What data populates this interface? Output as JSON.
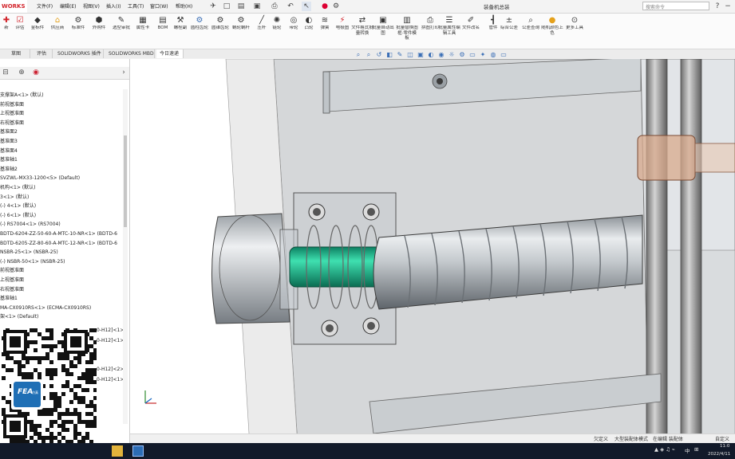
{
  "app": {
    "brand": "WORKS",
    "document_title": "装备机总装"
  },
  "menu": [
    "文件(F)",
    "编辑(E)",
    "视图(V)",
    "插入(I)",
    "工具(T)",
    "窗口(W)",
    "帮助(H)"
  ],
  "search": {
    "placeholder": "搜索命令"
  },
  "ribbon": [
    {
      "label": "新",
      "icon": "new-icon"
    },
    {
      "label": "评估",
      "icon": "evaluate-icon"
    },
    {
      "label": "金标件",
      "icon": "gold-part-icon"
    },
    {
      "label": "供应商",
      "icon": "supplier-icon"
    },
    {
      "label": "标准件",
      "icon": "standard-part-icon"
    },
    {
      "label": "外购件",
      "icon": "purchased-part-icon"
    },
    {
      "label": "选型审批",
      "icon": "approval-icon"
    },
    {
      "label": "属性卡",
      "icon": "property-card-icon"
    },
    {
      "label": "BOM",
      "icon": "bom-icon"
    },
    {
      "label": "螺栓副",
      "icon": "bolt-icon"
    },
    {
      "label": "圆柱齿轮",
      "icon": "spur-gear-icon"
    },
    {
      "label": "圆锥齿轮",
      "icon": "bevel-gear-icon"
    },
    {
      "label": "蜗轮蜗杆",
      "icon": "worm-gear-icon"
    },
    {
      "label": "压杆",
      "icon": "strut-icon"
    },
    {
      "label": "链轮",
      "icon": "sprocket-icon"
    },
    {
      "label": "带轮",
      "icon": "pulley-icon"
    },
    {
      "label": "凸轮",
      "icon": "cam-icon"
    },
    {
      "label": "弹簧",
      "icon": "spring-icon"
    },
    {
      "label": "电极图",
      "icon": "electrode-icon"
    },
    {
      "label": "文件格式批量转换",
      "icon": "batch-convert-icon"
    },
    {
      "label": "批量自动出图",
      "icon": "auto-drawing-icon"
    },
    {
      "label": "批量替换图框·零件模板",
      "icon": "replace-template-icon"
    },
    {
      "label": "拼图打印",
      "icon": "print-icon"
    },
    {
      "label": "批量属性编辑工具",
      "icon": "batch-property-icon"
    },
    {
      "label": "文件改名",
      "icon": "rename-icon"
    },
    {
      "label": "管件",
      "icon": "pipe-icon"
    },
    {
      "label": "综合公差",
      "icon": "tolerance-icon"
    },
    {
      "label": "公差查询",
      "icon": "tolerance-query-icon"
    },
    {
      "label": "随机颜色上色",
      "icon": "random-color-icon"
    },
    {
      "label": "更多工具",
      "icon": "more-tools-icon"
    }
  ],
  "tabs": [
    {
      "label": "草图",
      "active": false
    },
    {
      "label": "评估",
      "active": false
    },
    {
      "label": "SOLIDWORKS 插件",
      "active": false
    },
    {
      "label": "SOLIDWORKS MBD",
      "active": false
    },
    {
      "label": "今日速递",
      "active": true
    }
  ],
  "tree": [
    "支撑架A<1> (默认)",
    "前视基准面",
    "上视基准面",
    "右视基准面",
    "基准面2",
    "基准面3",
    "基准面4",
    "基准轴1",
    "基准轴2",
    "SVZWL-MX33-1200<5> (Default)",
    "机构<1> (默认)",
    "3<1> (默认)",
    "(-) 4<1> (默认)",
    "(-) 6<1> (默认)",
    "(-) RS7004<1> (RS7004)",
    "BDTD-6204-ZZ-50-60-A-MTC-10-NR<1> (BDTD-6",
    "BDTD-6205-ZZ-80-60-A-MTC-12-NR<1> (BDTD-6",
    "NSBR-25<1> (NSBR-25)",
    "(-) NSBR-50<1> (NSBR-25)",
    "前视基准面",
    "上视基准面",
    "右视基准面",
    "基准轴1",
    "MA-CX0910RS<1> (ECMA-CX0910RS)",
    "架<1> (Default)"
  ],
  "tree_partial": [
    "0-H12]<1>",
    "0-H12]<1>",
    "0-H12]<2>",
    "0-H12]<1>"
  ],
  "status": {
    "left": "欠定义",
    "mode": "大型装配体模式",
    "edit": "在编辑 装配体",
    "units": "自定义"
  },
  "tray": {
    "time": "11:0",
    "date": "2022/4/11",
    "ime": "中"
  },
  "watermark": {
    "logo_text": "FEA",
    "logo_sub": "仿真"
  }
}
